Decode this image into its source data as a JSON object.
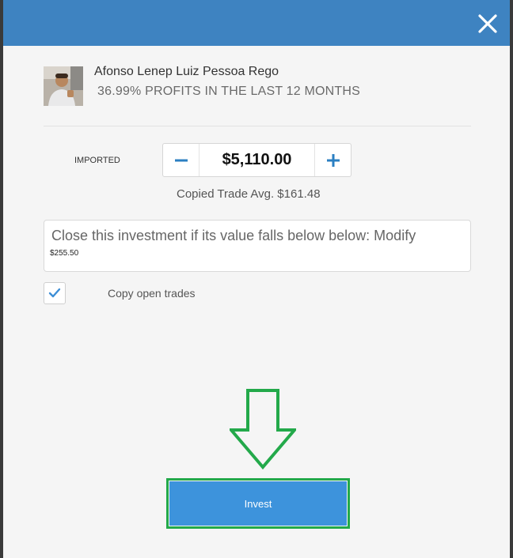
{
  "trader": {
    "name": "Afonso Lenep Luiz Pessoa Rego",
    "profit_text": "36.99% PROFITS IN THE LAST 12 MONTHS"
  },
  "amount": {
    "label": "IMPORTED",
    "value": "$5,110.00"
  },
  "copied_trade_avg": "Copied Trade Avg. $161.48",
  "stop_loss": {
    "text": "Close this investment if its value falls below below: Modify",
    "value": "$255.50"
  },
  "copy_open_trades": {
    "label": "Copy open trades",
    "checked": true
  },
  "invest_button": {
    "label": "Invest"
  },
  "colors": {
    "header": "#3e83c1",
    "accent": "#3d93dc",
    "highlight": "#23a94a"
  }
}
